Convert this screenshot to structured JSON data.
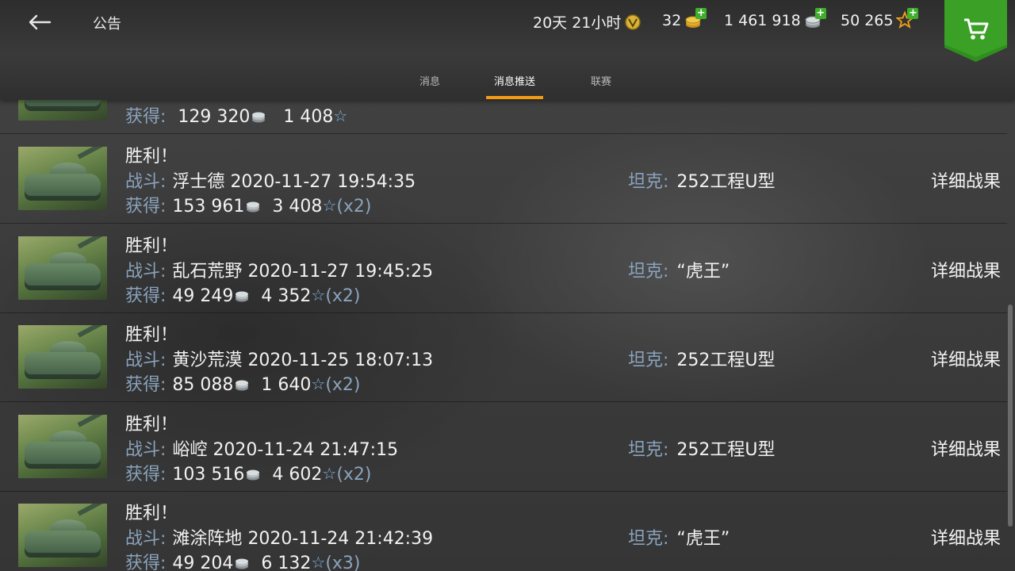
{
  "header": {
    "title": "公告",
    "resources": {
      "timer": "20天 21小时",
      "gold": "32",
      "credits": "1 461 918",
      "free_xp": "50 265"
    }
  },
  "tabs": [
    {
      "label": "消息",
      "active": false
    },
    {
      "label": "消息推送",
      "active": true
    },
    {
      "label": "联赛",
      "active": false
    }
  ],
  "labels": {
    "battle": "战斗:",
    "earned": "获得:",
    "tank": "坦克:",
    "details": "详细战果"
  },
  "partial_row": {
    "credits": "129 320",
    "xp": "1 408"
  },
  "battles": [
    {
      "result": "胜利！",
      "map": "浮士德",
      "datetime": "2020-11-27 19:54:35",
      "credits": "153 961",
      "xp": "3 408",
      "multiplier": "(x2)",
      "tank": "252工程U型"
    },
    {
      "result": "胜利！",
      "map": "乱石荒野",
      "datetime": "2020-11-27 19:45:25",
      "credits": "49 249",
      "xp": "4 352",
      "multiplier": "(x2)",
      "tank": "“虎王”"
    },
    {
      "result": "胜利！",
      "map": "黄沙荒漠",
      "datetime": "2020-11-25 18:07:13",
      "credits": "85 088",
      "xp": "1 640",
      "multiplier": "(x2)",
      "tank": "252工程U型"
    },
    {
      "result": "胜利！",
      "map": "峪崆",
      "datetime": "2020-11-24 21:47:15",
      "credits": "103 516",
      "xp": "4 602",
      "multiplier": "(x2)",
      "tank": "252工程U型"
    },
    {
      "result": "胜利！",
      "map": "滩涂阵地",
      "datetime": "2020-11-24 21:42:39",
      "credits": "49 204",
      "xp": "6 132",
      "multiplier": "(x3)",
      "tank": "“虎王”"
    }
  ],
  "colors": {
    "accent": "#f29a12",
    "label_blue": "#8aa3bd",
    "shop_green": "#2f8f1e",
    "plus_green": "#3fae2b"
  },
  "icons": [
    "back-arrow-icon",
    "premium-timer-icon",
    "gold-coin-icon",
    "silver-coin-icon",
    "star-xp-icon",
    "shopping-cart-icon"
  ]
}
